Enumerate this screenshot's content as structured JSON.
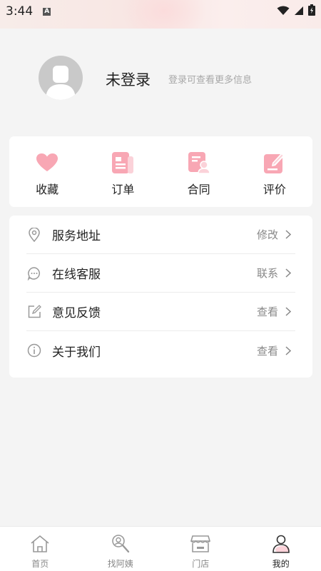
{
  "status_bar": {
    "time": "3:44",
    "notification_icon": "A",
    "icons": [
      "wifi-icon",
      "signal-icon",
      "battery-icon"
    ]
  },
  "profile": {
    "name": "未登录",
    "hint": "登录可查看更多信息",
    "avatar_icon": "user-avatar-icon"
  },
  "quick_actions": [
    {
      "label": "收藏",
      "icon": "heart-icon"
    },
    {
      "label": "订单",
      "icon": "order-document-icon"
    },
    {
      "label": "合同",
      "icon": "contract-icon"
    },
    {
      "label": "评价",
      "icon": "review-edit-icon"
    }
  ],
  "menu": [
    {
      "label": "服务地址",
      "action": "修改",
      "icon": "location-pin-icon"
    },
    {
      "label": "在线客服",
      "action": "联系",
      "icon": "chat-bubble-icon"
    },
    {
      "label": "意见反馈",
      "action": "查看",
      "icon": "feedback-edit-icon"
    },
    {
      "label": "关于我们",
      "action": "查看",
      "icon": "info-icon"
    }
  ],
  "tabbar": [
    {
      "label": "首页",
      "icon": "home-icon",
      "active": false
    },
    {
      "label": "找阿姨",
      "icon": "search-person-icon",
      "active": false
    },
    {
      "label": "门店",
      "icon": "store-icon",
      "active": false
    },
    {
      "label": "我的",
      "icon": "profile-icon",
      "active": true
    }
  ],
  "colors": {
    "accent_pink": "#f8a7b4",
    "accent_pink_light": "#fbd2d9",
    "background": "#f4f4f4",
    "card": "#ffffff",
    "text_primary": "#222222",
    "text_secondary": "#888888",
    "text_hint": "#a8a8a8"
  }
}
